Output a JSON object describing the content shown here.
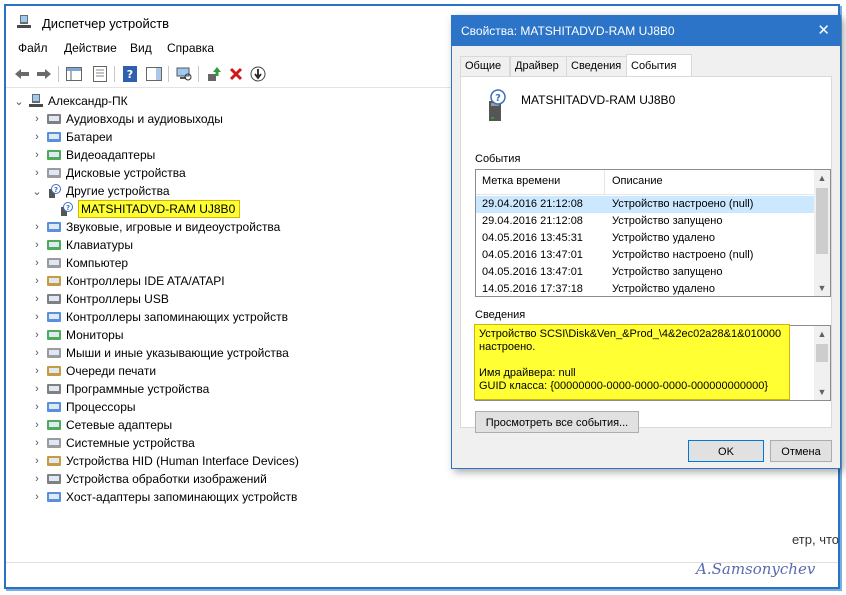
{
  "device_manager": {
    "title": "Диспетчер устройств",
    "menu": [
      "Файл",
      "Действие",
      "Вид",
      "Справка"
    ],
    "window_buttons": {
      "minimize": "—",
      "maximize": "☐",
      "close": "✕"
    },
    "tree": {
      "root": "Александр-ПК",
      "items": [
        {
          "label": "Аудиовходы и аудиовыходы",
          "icon": "audio-icon"
        },
        {
          "label": "Батареи",
          "icon": "battery-icon"
        },
        {
          "label": "Видеоадаптеры",
          "icon": "display-adapter-icon"
        },
        {
          "label": "Дисковые устройства",
          "icon": "disk-icon"
        },
        {
          "label": "Другие устройства",
          "icon": "unknown-device-icon",
          "expanded": true
        },
        {
          "label": "MATSHITADVD-RAM UJ8B0",
          "icon": "unknown-device-icon",
          "child": true,
          "highlighted": true
        },
        {
          "label": "Звуковые, игровые и видеоустройства",
          "icon": "sound-icon"
        },
        {
          "label": "Клавиатуры",
          "icon": "keyboard-icon"
        },
        {
          "label": "Компьютер",
          "icon": "computer-icon"
        },
        {
          "label": "Контроллеры IDE ATA/ATAPI",
          "icon": "ide-controller-icon"
        },
        {
          "label": "Контроллеры USB",
          "icon": "usb-icon"
        },
        {
          "label": "Контроллеры запоминающих устройств",
          "icon": "storage-controller-icon"
        },
        {
          "label": "Мониторы",
          "icon": "monitor-icon"
        },
        {
          "label": "Мыши и иные указывающие устройства",
          "icon": "mouse-icon"
        },
        {
          "label": "Очереди печати",
          "icon": "printer-icon"
        },
        {
          "label": "Программные устройства",
          "icon": "software-device-icon"
        },
        {
          "label": "Процессоры",
          "icon": "cpu-icon"
        },
        {
          "label": "Сетевые адаптеры",
          "icon": "network-icon"
        },
        {
          "label": "Системные устройства",
          "icon": "system-device-icon"
        },
        {
          "label": "Устройства HID (Human Interface Devices)",
          "icon": "hid-icon"
        },
        {
          "label": "Устройства обработки изображений",
          "icon": "camera-icon"
        },
        {
          "label": "Хост-адаптеры запоминающих устройств",
          "icon": "storage-host-icon"
        }
      ]
    },
    "behind_text": "етр, что",
    "watermark": "A.Samsonychev"
  },
  "dialog": {
    "title": "Свойства: MATSHITADVD-RAM UJ8B0",
    "tabs": [
      "Общие",
      "Драйвер",
      "Сведения",
      "События"
    ],
    "active_tab": "События",
    "device_name": "MATSHITADVD-RAM UJ8B0",
    "events_label": "События",
    "events_columns": [
      "Метка времени",
      "Описание"
    ],
    "events": [
      {
        "time": "29.04.2016 21:12:08",
        "desc": "Устройство настроено (null)"
      },
      {
        "time": "29.04.2016 21:12:08",
        "desc": "Устройство запущено"
      },
      {
        "time": "04.05.2016 13:45:31",
        "desc": "Устройство удалено"
      },
      {
        "time": "04.05.2016 13:47:01",
        "desc": "Устройство настроено (null)"
      },
      {
        "time": "04.05.2016 13:47:01",
        "desc": "Устройство запущено"
      },
      {
        "time": "14.05.2016 17:37:18",
        "desc": "Устройство удалено"
      }
    ],
    "details_label": "Сведения",
    "details_lines": [
      "Устройство SCSI\\Disk&Ven_&Prod_\\4&2ec02a28&1&010000",
      "настроено.",
      "",
      "Имя драйвера: null",
      "GUID класса: {00000000-0000-0000-0000-000000000000}"
    ],
    "view_all_button": "Просмотреть все события...",
    "ok_button": "OK",
    "cancel_button": "Отмена",
    "close_glyph": "✕"
  },
  "colors": {
    "accent": "#2b74c8",
    "highlight": "#ffff33",
    "selection": "#cce8ff"
  }
}
